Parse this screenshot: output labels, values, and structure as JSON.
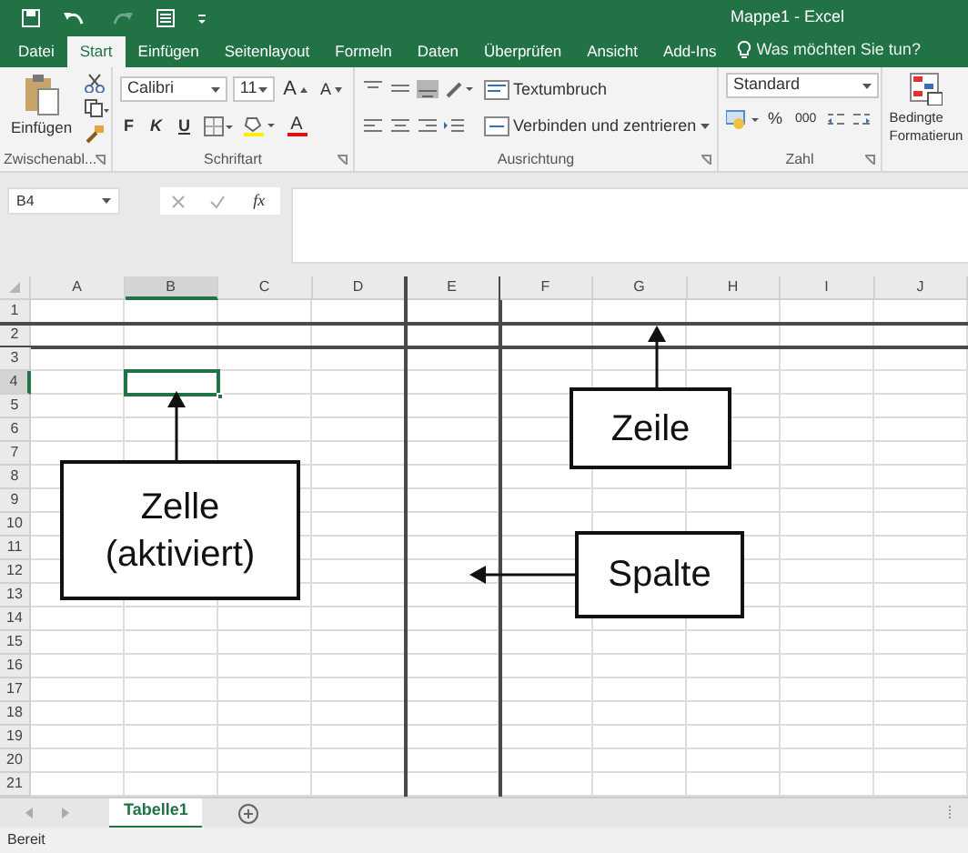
{
  "window": {
    "title": "Mappe1 - Excel"
  },
  "tabs": [
    {
      "label": "Datei",
      "selected": false
    },
    {
      "label": "Start",
      "selected": true
    },
    {
      "label": "Einfügen",
      "selected": false
    },
    {
      "label": "Seitenlayout",
      "selected": false
    },
    {
      "label": "Formeln",
      "selected": false
    },
    {
      "label": "Daten",
      "selected": false
    },
    {
      "label": "Überprüfen",
      "selected": false
    },
    {
      "label": "Ansicht",
      "selected": false
    },
    {
      "label": "Add-Ins",
      "selected": false
    }
  ],
  "tell_me": {
    "placeholder": "Was möchten Sie tun?"
  },
  "ribbon": {
    "paste_label": "Einfügen",
    "font": "Calibri",
    "font_size": "11",
    "size_buttons": [
      "A",
      "A"
    ],
    "format_buttons": [
      "F",
      "K",
      "U"
    ],
    "font_color_label": "A",
    "wrap_text": "Textumbruch",
    "merge_center": "Verbinden und zentrieren",
    "number_format": "Standard",
    "number_buttons": [
      "%",
      "000"
    ],
    "conditional_format": "Bedingte\nFormatierun",
    "group_labels": [
      "Zwischenabl...",
      "Schriftart",
      "Ausrichtung",
      "Zahl"
    ]
  },
  "formula_bar": {
    "name_box": "B4",
    "function_label": "fx"
  },
  "sheet": {
    "columns": [
      {
        "label": "A",
        "selected": false,
        "highlighted": false
      },
      {
        "label": "B",
        "selected": true,
        "highlighted": false
      },
      {
        "label": "C",
        "selected": false,
        "highlighted": false
      },
      {
        "label": "D",
        "selected": false,
        "highlighted": false
      },
      {
        "label": "E",
        "selected": false,
        "highlighted": true
      },
      {
        "label": "F",
        "selected": false,
        "highlighted": false
      },
      {
        "label": "G",
        "selected": false,
        "highlighted": false
      },
      {
        "label": "H",
        "selected": false,
        "highlighted": false
      },
      {
        "label": "I",
        "selected": false,
        "highlighted": false
      },
      {
        "label": "J",
        "selected": false,
        "highlighted": false
      }
    ],
    "rows": [
      {
        "label": "1",
        "selected": false,
        "highlighted": false
      },
      {
        "label": "2",
        "selected": false,
        "highlighted": true
      },
      {
        "label": "3",
        "selected": false,
        "highlighted": false
      },
      {
        "label": "4",
        "selected": true,
        "highlighted": false
      },
      {
        "label": "5",
        "selected": false,
        "highlighted": false
      },
      {
        "label": "6",
        "selected": false,
        "highlighted": false
      },
      {
        "label": "7",
        "selected": false,
        "highlighted": false
      },
      {
        "label": "8",
        "selected": false,
        "highlighted": false
      },
      {
        "label": "9",
        "selected": false,
        "highlighted": false
      },
      {
        "label": "10",
        "selected": false,
        "highlighted": false
      },
      {
        "label": "11",
        "selected": false,
        "highlighted": false
      },
      {
        "label": "12",
        "selected": false,
        "highlighted": false
      },
      {
        "label": "13",
        "selected": false,
        "highlighted": false
      },
      {
        "label": "14",
        "selected": false,
        "highlighted": false
      },
      {
        "label": "15",
        "selected": false,
        "highlighted": false
      },
      {
        "label": "16",
        "selected": false,
        "highlighted": false
      },
      {
        "label": "17",
        "selected": false,
        "highlighted": false
      },
      {
        "label": "18",
        "selected": false,
        "highlighted": false
      },
      {
        "label": "19",
        "selected": false,
        "highlighted": false
      },
      {
        "label": "20",
        "selected": false,
        "highlighted": false
      },
      {
        "label": "21",
        "selected": false,
        "highlighted": false
      }
    ]
  },
  "annotations": [
    {
      "kind": "cell",
      "text": "Zelle\n(aktiviert)"
    },
    {
      "kind": "row",
      "text": "Zeile"
    },
    {
      "kind": "column",
      "text": "Spalte"
    }
  ],
  "sheet_tabs": [
    {
      "label": "Tabelle1",
      "selected": true
    }
  ],
  "status_bar": "Bereit"
}
